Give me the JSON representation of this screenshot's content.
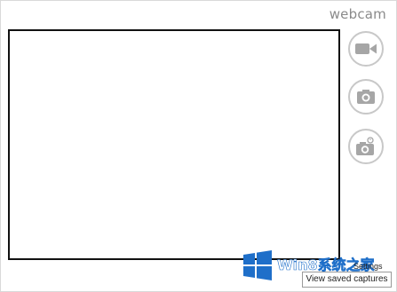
{
  "app": {
    "title": "webcam"
  },
  "controls": {
    "video_icon": "video-camera-icon",
    "photo_icon": "camera-icon",
    "timer_icon": "timer-camera-icon"
  },
  "links": {
    "settings": "Settings",
    "saved_captures": "View saved captures"
  },
  "watermark": {
    "text": "Win8系统之家"
  },
  "colors": {
    "button_border": "#c8c8c8",
    "icon_fill": "#a6a6a6",
    "watermark_blue": "#1f6fc9"
  }
}
